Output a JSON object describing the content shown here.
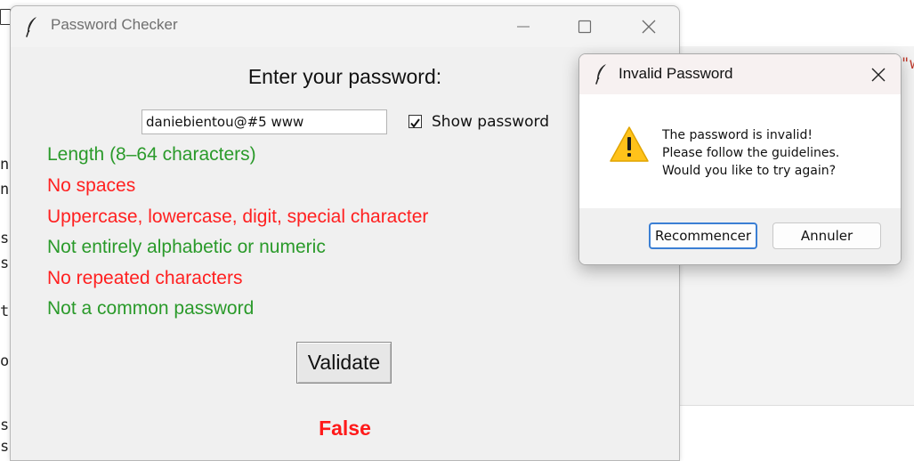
{
  "main_window": {
    "title": "Password Checker",
    "heading": "Enter your password:",
    "password_value": "daniebientou@#5 www",
    "show_password_label": "Show password",
    "show_password_checked": true,
    "rules": [
      {
        "text": "Length (8–64 characters)",
        "status": "pass",
        "color": "#2a9a2a"
      },
      {
        "text": "No spaces",
        "status": "fail",
        "color": "#ff2020"
      },
      {
        "text": "Uppercase, lowercase, digit, special character",
        "status": "fail",
        "color": "#ff2020"
      },
      {
        "text": "Not entirely alphabetic or numeric",
        "status": "pass",
        "color": "#2a9a2a"
      },
      {
        "text": "No repeated characters",
        "status": "fail",
        "color": "#ff2020"
      },
      {
        "text": "Not a common password",
        "status": "pass",
        "color": "#2a9a2a"
      }
    ],
    "validate_label": "Validate",
    "result_text": "False",
    "result_color": "#ff1a1a",
    "window_controls": [
      "minimize-icon",
      "maximize-icon",
      "close-icon"
    ]
  },
  "dialog": {
    "title": "Invalid Password",
    "message_lines": [
      "The password is invalid!",
      "Please follow the guidelines.",
      "Would you like to try again?"
    ],
    "icon": "warning-icon",
    "retry_label": "Recommencer",
    "cancel_label": "Annuler"
  },
  "background": {
    "gutter_chars": [
      "n",
      "n",
      "s",
      "s",
      "t",
      "o",
      "s",
      "s"
    ],
    "right_fragment": "\"w"
  }
}
